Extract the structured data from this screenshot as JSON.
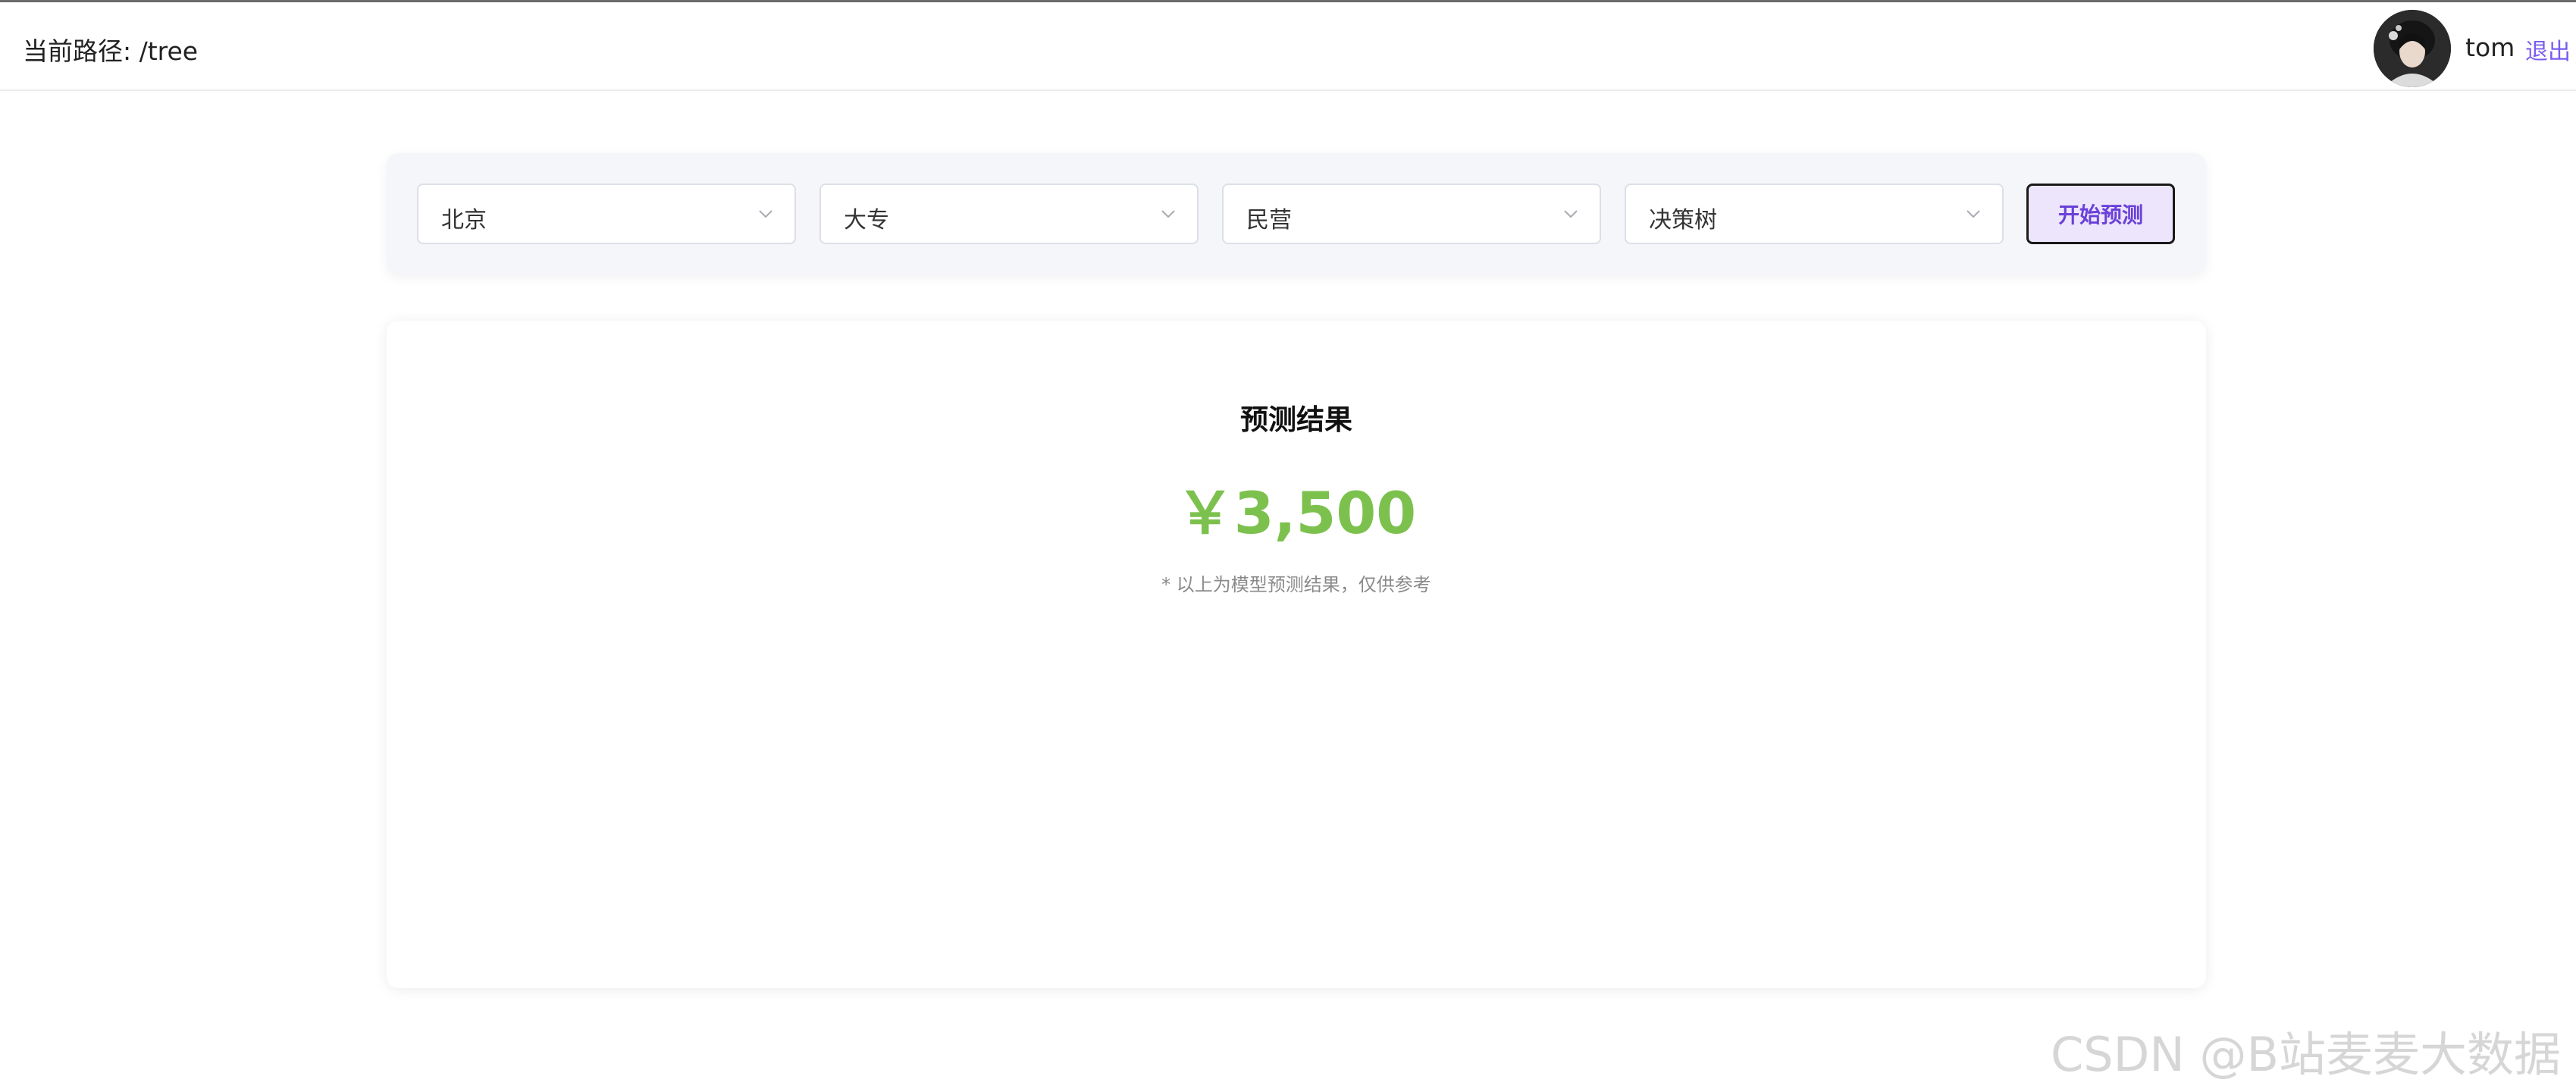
{
  "header": {
    "breadcrumb": "当前路径: /tree",
    "username": "tom",
    "logout_label": "退出"
  },
  "filters": {
    "city": "北京",
    "education": "大专",
    "company_type": "民营",
    "model": "决策树",
    "predict_label": "开始预测"
  },
  "result": {
    "title": "预测结果",
    "value": "￥3,500",
    "note": "* 以上为模型预测结果，仅供参考"
  },
  "watermark": "CSDN @B站麦麦大数据",
  "colors": {
    "accent": "#7a5cf0",
    "result_value": "#7cc14e",
    "button_bg": "#ece5fb"
  }
}
